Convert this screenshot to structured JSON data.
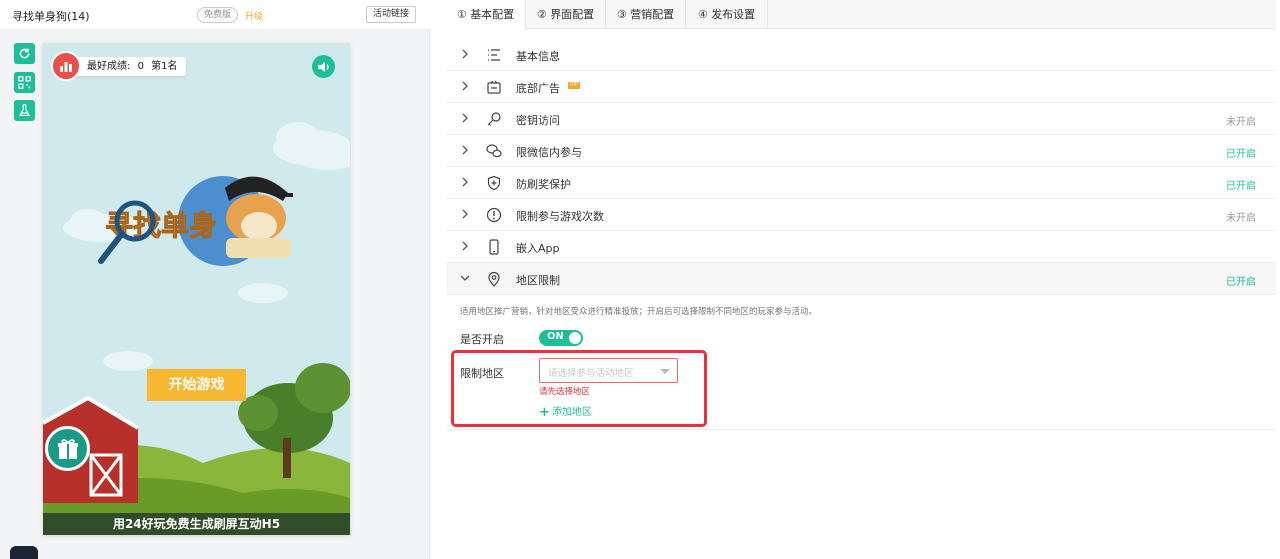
{
  "header": {
    "title": "寻找单身狗(14)",
    "version_badge": "免费版",
    "upgrade_label": "升级",
    "activity_link_label": "活动链接"
  },
  "side_tools": [
    {
      "icon": "refresh-icon"
    },
    {
      "icon": "qrcode-icon"
    },
    {
      "icon": "flask-icon"
    }
  ],
  "preview": {
    "best_score_label": "最好成绩:",
    "best_score_value": "0",
    "rank": "第1名",
    "start_button_label": "开始游戏",
    "promo_banner": "用24好玩免费生成刷屏互动H5",
    "logo_text": "寻找单身"
  },
  "tabs": [
    {
      "num": "①",
      "label": "基本配置",
      "active": true
    },
    {
      "num": "②",
      "label": "界面配置",
      "active": false
    },
    {
      "num": "③",
      "label": "营销配置",
      "active": false
    },
    {
      "num": "④",
      "label": "发布设置",
      "active": false
    }
  ],
  "settings": [
    {
      "label": "基本信息",
      "status": "",
      "icon": "list-icon"
    },
    {
      "label": "底部广告",
      "status": "",
      "icon": "ad-icon",
      "vip": true
    },
    {
      "label": "密钥访问",
      "status": "未开启",
      "icon": "key-icon"
    },
    {
      "label": "限微信内参与",
      "status": "已开启",
      "icon": "wechat-icon"
    },
    {
      "label": "防刷奖保护",
      "status": "已开启",
      "icon": "shield-icon"
    },
    {
      "label": "限制参与游戏次数",
      "status": "未开启",
      "icon": "alert-icon"
    },
    {
      "label": "嵌入App",
      "status": "",
      "icon": "phone-icon"
    },
    {
      "label": "地区限制",
      "status": "已开启",
      "icon": "location-icon",
      "expanded": true
    }
  ],
  "region": {
    "description": "适用地区推广营销，针对地区受众进行精准投放；开启后可选择限制不同地区的玩家参与活动。",
    "enable_label": "是否开启",
    "toggle_text": "ON",
    "limit_label": "限制地区",
    "select_placeholder": "请选择参与活动地区",
    "error_text": "请先选择地区",
    "add_label": "添加地区"
  },
  "colors": {
    "accent": "#1dbf98",
    "error": "#e8323c",
    "upgrade": "#f5a623",
    "start_button": "#f7b731"
  }
}
